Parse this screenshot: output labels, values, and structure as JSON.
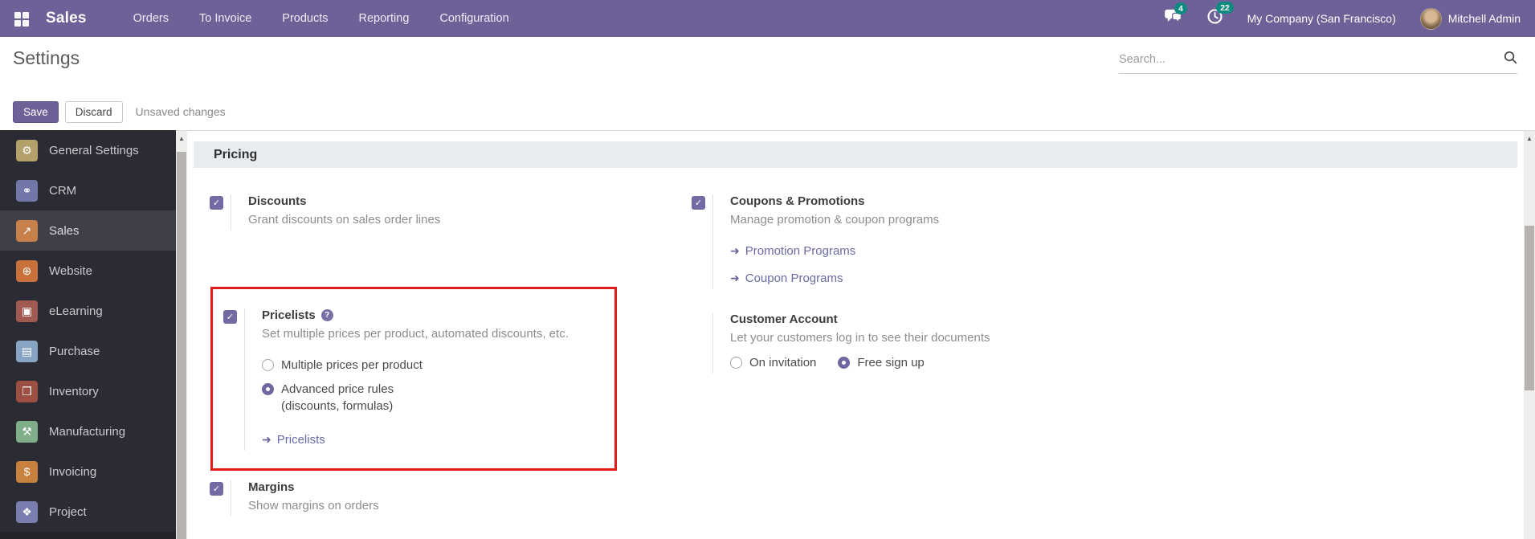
{
  "glyphs": {
    "check": "✓",
    "help": "?",
    "link_arrow": "➜",
    "scroll_up": "▲"
  },
  "topbar": {
    "brand": "Sales",
    "menu": [
      {
        "label": "Orders"
      },
      {
        "label": "To Invoice"
      },
      {
        "label": "Products"
      },
      {
        "label": "Reporting"
      },
      {
        "label": "Configuration"
      }
    ],
    "messages_badge": "4",
    "activities_badge": "22",
    "company": "My Company (San Francisco)",
    "user": "Mitchell Admin"
  },
  "page": {
    "title": "Settings",
    "search_placeholder": "Search..."
  },
  "toolbar": {
    "save": "Save",
    "discard": "Discard",
    "status": "Unsaved changes"
  },
  "sidebar": {
    "items": [
      {
        "label": "General Settings",
        "glyph": "⚙",
        "color": "#b3a06b",
        "active": false
      },
      {
        "label": "CRM",
        "glyph": "⚭",
        "color": "#7177a8",
        "active": false
      },
      {
        "label": "Sales",
        "glyph": "↗",
        "color": "#c8804a",
        "active": true
      },
      {
        "label": "Website",
        "glyph": "⊕",
        "color": "#c9713a",
        "active": false
      },
      {
        "label": "eLearning",
        "glyph": "▣",
        "color": "#a05a52",
        "active": false
      },
      {
        "label": "Purchase",
        "glyph": "▤",
        "color": "#86a4c4",
        "active": false
      },
      {
        "label": "Inventory",
        "glyph": "❒",
        "color": "#9e4f43",
        "active": false
      },
      {
        "label": "Manufacturing",
        "glyph": "⚒",
        "color": "#7fae88",
        "active": false
      },
      {
        "label": "Invoicing",
        "glyph": "$",
        "color": "#c8813f",
        "active": false
      },
      {
        "label": "Project",
        "glyph": "❖",
        "color": "#797eae",
        "active": false
      }
    ]
  },
  "content": {
    "section_title": "Pricing",
    "discounts": {
      "checked": true,
      "label": "Discounts",
      "desc": "Grant discounts on sales order lines"
    },
    "pricelists": {
      "checked": true,
      "highlighted": true,
      "label": "Pricelists",
      "desc": "Set multiple prices per product, automated discounts, etc.",
      "options": [
        {
          "label": "Multiple prices per product",
          "selected": false
        },
        {
          "label": "Advanced price rules",
          "selected": true,
          "sub": "(discounts, formulas)"
        }
      ],
      "link": "Pricelists"
    },
    "margins": {
      "checked": true,
      "label": "Margins",
      "desc": "Show margins on orders"
    },
    "coupons": {
      "checked": true,
      "label": "Coupons & Promotions",
      "desc": "Manage promotion & coupon programs",
      "links": [
        "Promotion Programs",
        "Coupon Programs"
      ]
    },
    "customer_account": {
      "label": "Customer Account",
      "desc": "Let your customers log in to see their documents",
      "options": [
        {
          "label": "On invitation",
          "selected": false
        },
        {
          "label": "Free sign up",
          "selected": true
        }
      ]
    }
  },
  "colors": {
    "navbar": "#6e6198",
    "accent": "#7469a3",
    "badge": "#0f8a80",
    "highlight_border": "#e01b1b",
    "section_bg": "#e9ecef",
    "sidebar_bg": "#2b2b33",
    "sidebar_active_bg": "#3f3f48"
  }
}
